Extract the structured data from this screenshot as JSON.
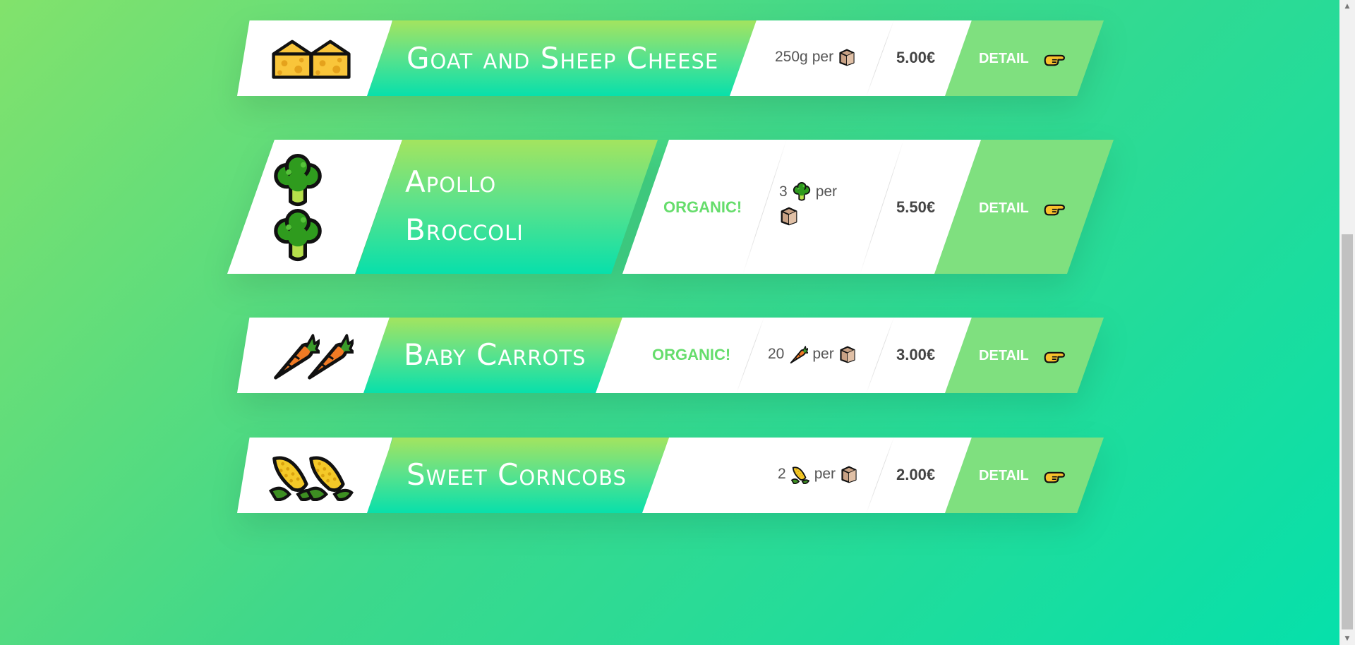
{
  "products": [
    {
      "name": "Goat and Sheep Cheese",
      "icon": "cheese-icon",
      "organic": "",
      "quantity": "250g",
      "unit_word": "per",
      "quantity_icon": "",
      "package_icon": "box-icon",
      "price": "5.00€",
      "detail_label": "DETAIL",
      "detail_icon": "pointing-hand-icon"
    },
    {
      "name": "Apollo Broccoli",
      "icon": "broccoli-icon",
      "organic": "ORGANIC!",
      "quantity": "3",
      "unit_word": "per",
      "quantity_icon": "broccoli-icon",
      "package_icon": "box-icon",
      "price": "5.50€",
      "detail_label": "DETAIL",
      "detail_icon": "pointing-hand-icon"
    },
    {
      "name": "Baby Carrots",
      "icon": "carrot-icon",
      "organic": "ORGANIC!",
      "quantity": "20",
      "unit_word": "per",
      "quantity_icon": "carrot-icon",
      "package_icon": "box-icon",
      "price": "3.00€",
      "detail_label": "DETAIL",
      "detail_icon": "pointing-hand-icon"
    },
    {
      "name": "Sweet Corncobs",
      "icon": "corn-icon",
      "organic": "",
      "quantity": "2",
      "unit_word": "per",
      "quantity_icon": "corn-icon",
      "package_icon": "box-icon",
      "price": "2.00€",
      "detail_label": "DETAIL",
      "detail_icon": "pointing-hand-icon"
    }
  ],
  "colors": {
    "organic": "#66dd6c",
    "detail_background": "#7fe07f",
    "title_gradient_top": "#a3e45f",
    "title_gradient_bottom": "#08e0ab"
  }
}
